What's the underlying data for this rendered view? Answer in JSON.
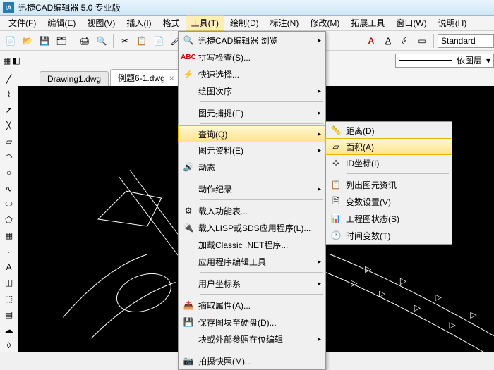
{
  "title": "迅捷CAD编辑器 5.0 专业版",
  "menu": {
    "file": "文件(F)",
    "edit": "编辑(E)",
    "view": "视图(V)",
    "insert": "插入(I)",
    "format": "格式",
    "tools": "工具(T)",
    "draw": "绘制(D)",
    "annotate": "标注(N)",
    "modify": "修改(M)",
    "extend": "拓展工具",
    "window": "窗口(W)",
    "help": "说明(H)"
  },
  "tabs": {
    "t1": "Drawing1.dwg",
    "t2": "例题6-1.dwg"
  },
  "linetype_label": "依图层",
  "style_label": "Standard",
  "tools_menu": {
    "browse": "迅捷CAD编辑器 浏览",
    "spell": "拼写检查(S)...",
    "quick": "快速选择...",
    "order": "绘图次序",
    "snap": "图元捕捉(E)",
    "query": "查询(Q)",
    "props": "图元资料(E)",
    "dynamic": "动态",
    "action": "动作纪录",
    "loadfn": "载入功能表...",
    "loadlisp": "载入LISP或SDS应用程序(L)...",
    "loadnet": "加载Classic .NET程序...",
    "apptools": "应用程序编辑工具",
    "ucs": "用户坐标系",
    "extract": "摘取属性(A)...",
    "saveblock": "保存图块至硬盘(D)...",
    "blockref": "块或外部参照在位编辑",
    "snapshot": "拍摄快照(M)..."
  },
  "query_menu": {
    "dist": "距离(D)",
    "area": "面积(A)",
    "id": "ID坐标(I)",
    "list": "列出图元资讯",
    "vars": "变数设置(V)",
    "status": "工程图状态(S)",
    "time": "时间变数(T)"
  }
}
